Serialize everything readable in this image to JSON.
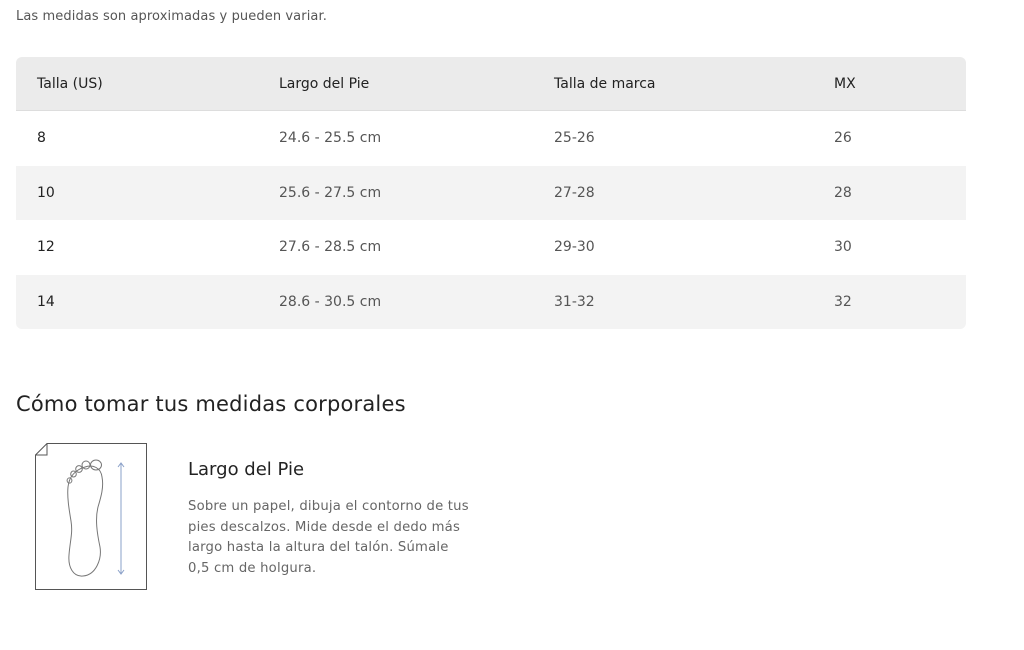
{
  "note": "Las medidas son aproximadas y pueden variar.",
  "table": {
    "headers": [
      "Talla (US)",
      "Largo del Pie",
      "Talla de marca",
      "MX"
    ],
    "rows": [
      [
        "8",
        "24.6 - 25.5 cm",
        "25-26",
        "26"
      ],
      [
        "10",
        "25.6 - 27.5 cm",
        "27-28",
        "28"
      ],
      [
        "12",
        "27.6 - 28.5 cm",
        "29-30",
        "30"
      ],
      [
        "14",
        "28.6 - 30.5 cm",
        "31-32",
        "32"
      ]
    ]
  },
  "measure": {
    "title": "Cómo tomar tus medidas corporales",
    "item_title": "Largo del Pie",
    "item_desc": "Sobre un papel, dibuja el contorno de tus pies descalzos. Mide desde el dedo más largo hasta la altura del talón. Súmale 0,5 cm de holgura.",
    "icon": "foot-measure-icon"
  },
  "colors": {
    "header_bg": "#ebebeb",
    "alt_row_bg": "#f3f3f3",
    "measure_line": "#8aa0c8"
  }
}
